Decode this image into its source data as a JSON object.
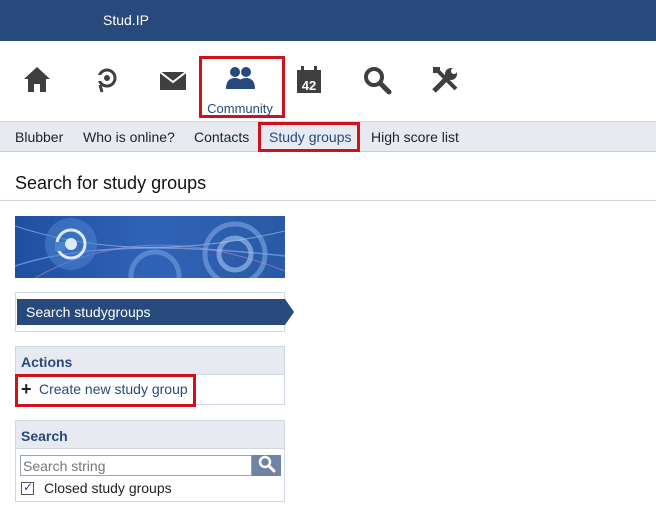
{
  "app": {
    "brand": "Stud.IP"
  },
  "main_nav": {
    "items": [
      {
        "icon": "home-icon"
      },
      {
        "icon": "activity-icon"
      },
      {
        "icon": "mail-icon"
      },
      {
        "icon": "community-icon",
        "label": "Community",
        "active": true
      },
      {
        "icon": "calendar-icon",
        "icon_text": "42"
      },
      {
        "icon": "search-icon"
      },
      {
        "icon": "tools-icon"
      }
    ]
  },
  "sub_nav": {
    "items": [
      "Blubber",
      "Who is online?",
      "Contacts",
      "Study groups",
      "High score list"
    ],
    "active": "Study groups"
  },
  "page": {
    "title": "Search for study groups"
  },
  "sidebar": {
    "navigation": {
      "item": "Search studygroups"
    },
    "actions": {
      "title": "Actions",
      "create_label": "Create new study group"
    },
    "search": {
      "title": "Search",
      "placeholder": "Search string",
      "closed_label": "Closed study groups",
      "closed_checked": true
    }
  },
  "colors": {
    "brand_blue": "#28497c",
    "highlight_red": "#d0111b",
    "header_bg": "#e7ebf1"
  }
}
